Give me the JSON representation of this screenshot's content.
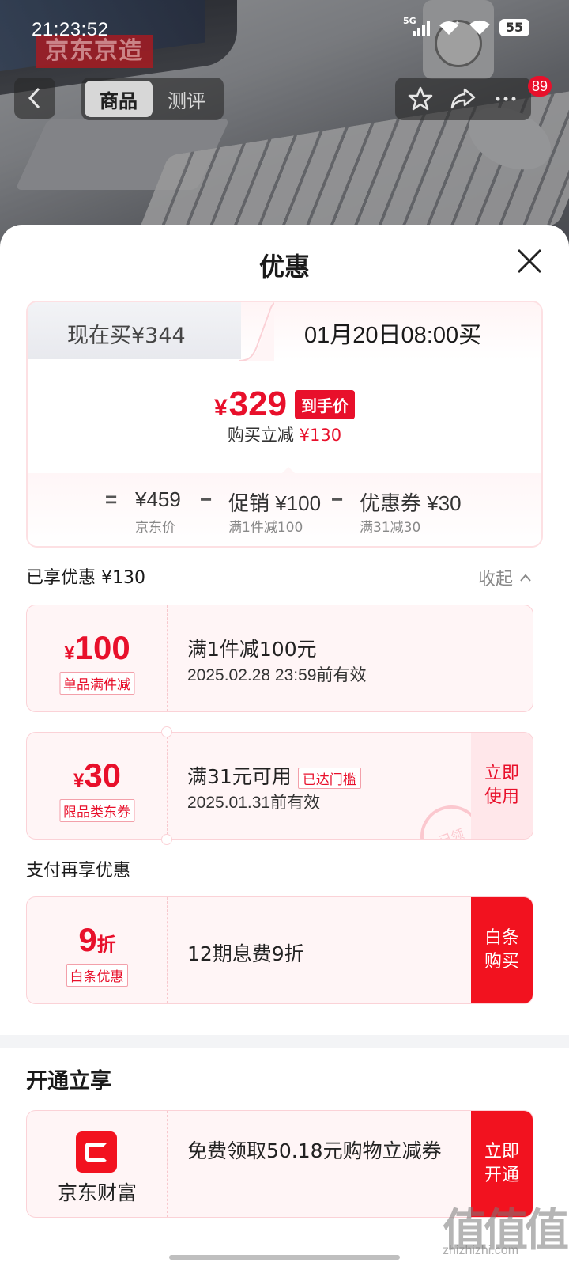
{
  "status_bar": {
    "time": "21:23:52",
    "network": "5G",
    "battery": "55"
  },
  "background": {
    "brand_text": "京东京造"
  },
  "nav": {
    "tabs": [
      {
        "label": "商品",
        "active": true
      },
      {
        "label": "测评",
        "active": false
      }
    ],
    "badge_count": "89"
  },
  "sheet": {
    "title": "优惠",
    "price_card": {
      "tab_now": "现在买¥344",
      "tab_later": "01月20日08:00买",
      "currency": "¥",
      "final_price": "329",
      "final_tag": "到手价",
      "reduce_label": "购买立减",
      "reduce_amount": "¥130",
      "breakdown": {
        "equals": "=",
        "base_value": "¥459",
        "base_label": "京东价",
        "minus1": "−",
        "promo_value": "促销 ¥100",
        "promo_label": "满1件减100",
        "minus2": "−",
        "coupon_value": "优惠券 ¥30",
        "coupon_label": "满31减30"
      }
    },
    "enjoyed": {
      "label": "已享优惠 ¥130",
      "collapse": "收起"
    },
    "coupons": [
      {
        "currency": "¥",
        "amount": "100",
        "tag": "单品满件减",
        "title": "满1件减100元",
        "validity": "2025.02.28 23:59前有效"
      },
      {
        "currency": "¥",
        "amount": "30",
        "tag": "限品类东券",
        "title": "满31元可用",
        "chip": "已达门槛",
        "validity": "2025.01.31前有效",
        "action": "立即使用",
        "stamp": "已领"
      }
    ],
    "pay_section": {
      "title": "支付再享优惠",
      "item": {
        "amount": "9",
        "unit": "折",
        "tag": "白条优惠",
        "title": "12期息费9折",
        "action": "白条购买"
      }
    },
    "open_section": {
      "title": "开通立享",
      "item": {
        "brand": "京东财富",
        "title": "免费领取50.18元购物立减券",
        "action": "立即开通"
      }
    }
  },
  "watermark": {
    "text": "值值值",
    "url": "zhizhizhi.com"
  },
  "colors": {
    "accent": "#e8102b",
    "accent_soft": "#fff5f6",
    "text": "#1a1a1a"
  }
}
